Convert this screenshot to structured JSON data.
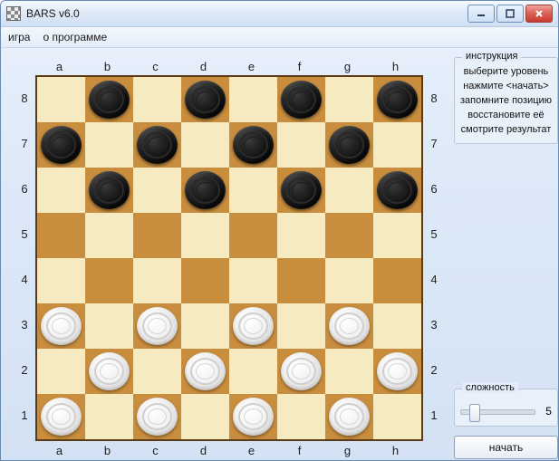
{
  "window": {
    "title": "BARS v6.0"
  },
  "menu": {
    "game": "игра",
    "about": "о программе"
  },
  "board": {
    "files": [
      "a",
      "b",
      "c",
      "d",
      "e",
      "f",
      "g",
      "h"
    ],
    "ranks_top_to_bottom": [
      "8",
      "7",
      "6",
      "5",
      "4",
      "3",
      "2",
      "1"
    ],
    "pieces": [
      {
        "file": "b",
        "rank": 8,
        "color": "black"
      },
      {
        "file": "d",
        "rank": 8,
        "color": "black"
      },
      {
        "file": "f",
        "rank": 8,
        "color": "black"
      },
      {
        "file": "h",
        "rank": 8,
        "color": "black"
      },
      {
        "file": "a",
        "rank": 7,
        "color": "black"
      },
      {
        "file": "c",
        "rank": 7,
        "color": "black"
      },
      {
        "file": "e",
        "rank": 7,
        "color": "black"
      },
      {
        "file": "g",
        "rank": 7,
        "color": "black"
      },
      {
        "file": "b",
        "rank": 6,
        "color": "black"
      },
      {
        "file": "d",
        "rank": 6,
        "color": "black"
      },
      {
        "file": "f",
        "rank": 6,
        "color": "black"
      },
      {
        "file": "h",
        "rank": 6,
        "color": "black"
      },
      {
        "file": "a",
        "rank": 3,
        "color": "white"
      },
      {
        "file": "c",
        "rank": 3,
        "color": "white"
      },
      {
        "file": "e",
        "rank": 3,
        "color": "white"
      },
      {
        "file": "g",
        "rank": 3,
        "color": "white"
      },
      {
        "file": "b",
        "rank": 2,
        "color": "white"
      },
      {
        "file": "d",
        "rank": 2,
        "color": "white"
      },
      {
        "file": "f",
        "rank": 2,
        "color": "white"
      },
      {
        "file": "h",
        "rank": 2,
        "color": "white"
      },
      {
        "file": "a",
        "rank": 1,
        "color": "white"
      },
      {
        "file": "c",
        "rank": 1,
        "color": "white"
      },
      {
        "file": "e",
        "rank": 1,
        "color": "white"
      },
      {
        "file": "g",
        "rank": 1,
        "color": "white"
      }
    ]
  },
  "instructions": {
    "legend": "инструкция",
    "lines": [
      "выберите уровень",
      "нажмите <начать>",
      "запомните позицию",
      "восстановите её",
      "смотрите результат"
    ]
  },
  "difficulty": {
    "legend": "сложность",
    "value": 5,
    "min": 1,
    "max": 20,
    "thumb_percent": 12
  },
  "buttons": {
    "start": "начать"
  }
}
